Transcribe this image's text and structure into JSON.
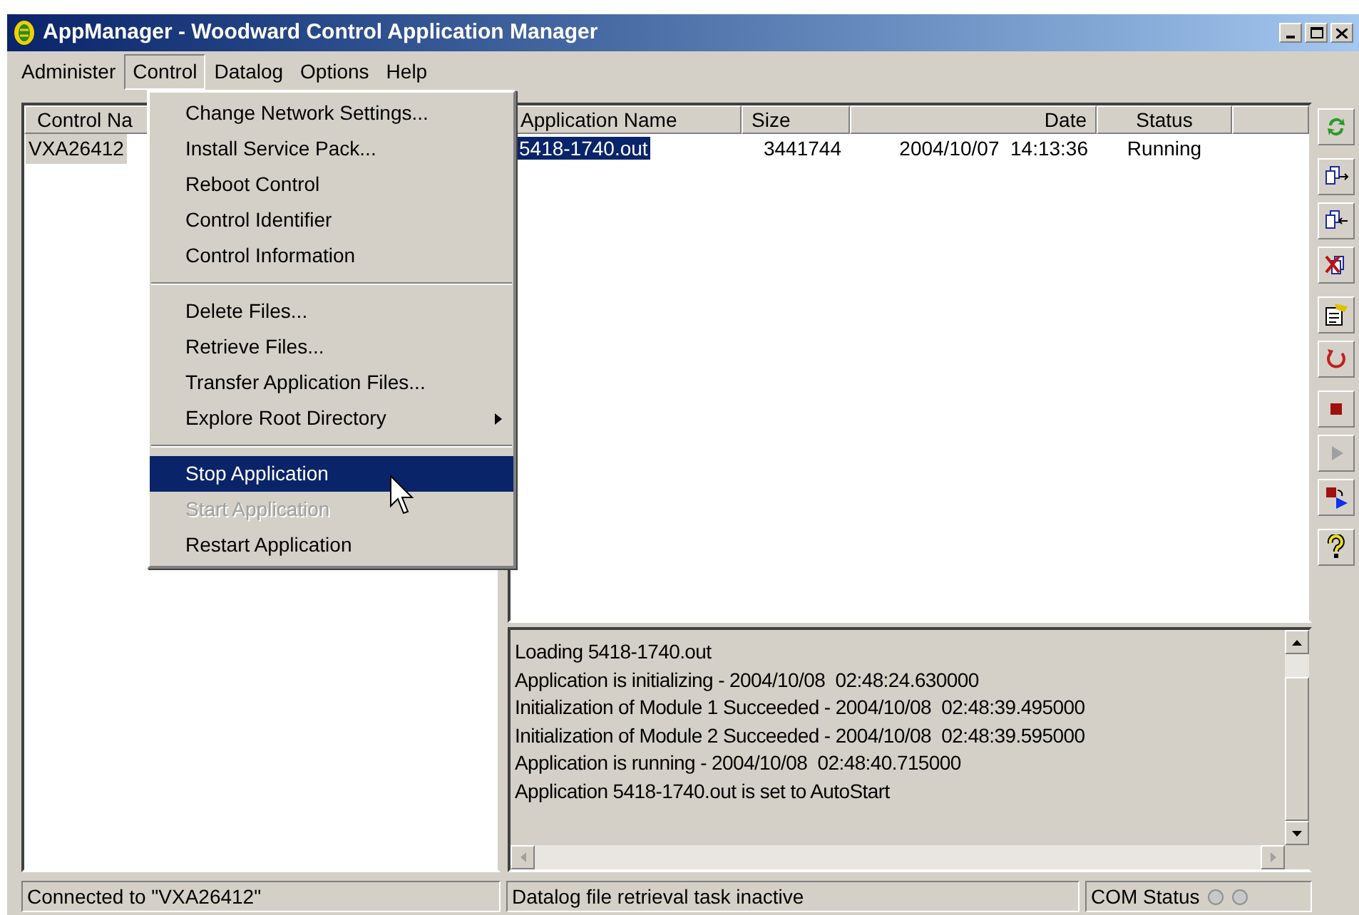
{
  "window": {
    "title": "AppManager - Woodward Control Application Manager"
  },
  "menu_bar": [
    {
      "label": "Administer",
      "selected": false
    },
    {
      "label": "Control",
      "selected": true
    },
    {
      "label": "Datalog",
      "selected": false
    },
    {
      "label": "Options",
      "selected": false
    },
    {
      "label": "Help",
      "selected": false
    }
  ],
  "dropdown": [
    {
      "kind": "item",
      "label": "Change Network Settings...",
      "selected": false,
      "disabled": false
    },
    {
      "kind": "item",
      "label": "Install Service Pack...",
      "selected": false,
      "disabled": false
    },
    {
      "kind": "item",
      "label": "Reboot Control",
      "selected": false,
      "disabled": false
    },
    {
      "kind": "item",
      "label": "Control Identifier",
      "selected": false,
      "disabled": false
    },
    {
      "kind": "item",
      "label": "Control Information",
      "selected": false,
      "disabled": false
    },
    {
      "kind": "separator"
    },
    {
      "kind": "item",
      "label": "Delete Files...",
      "selected": false,
      "disabled": false
    },
    {
      "kind": "item",
      "label": "Retrieve Files...",
      "selected": false,
      "disabled": false
    },
    {
      "kind": "item",
      "label": "Transfer Application Files...",
      "selected": false,
      "disabled": false
    },
    {
      "kind": "submenu",
      "label": "Explore Root Directory",
      "selected": false,
      "disabled": false
    },
    {
      "kind": "separator"
    },
    {
      "kind": "item",
      "label": "Stop Application",
      "selected": true,
      "disabled": false
    },
    {
      "kind": "item",
      "label": "Start Application",
      "selected": false,
      "disabled": true
    },
    {
      "kind": "item",
      "label": "Restart Application",
      "selected": false,
      "disabled": false
    }
  ],
  "controls_list": {
    "column": "Control Na",
    "rows": [
      {
        "name": "VXA26412",
        "selected": true
      }
    ]
  },
  "applications_table": {
    "columns": [
      "Application Name",
      "Size",
      "Date",
      "Status"
    ],
    "rows": [
      {
        "name": "5418-1740.out",
        "size": "3441744",
        "date": "2004/10/07  14:13:36",
        "status": "Running",
        "selected": true
      }
    ]
  },
  "log": [
    "Loading 5418-1740.out",
    "Application is initializing - 2004/10/08  02:48:24.630000",
    "Initialization of Module 1 Succeeded - 2004/10/08  02:48:39.495000",
    "Initialization of Module 2 Succeeded - 2004/10/08  02:48:39.595000",
    "Application is running - 2004/10/08  02:48:40.715000",
    "Application 5418-1740.out is set to AutoStart"
  ],
  "toolbar": [
    {
      "kind": "refresh",
      "disabled": false
    },
    {
      "kind": "copy-to",
      "disabled": false
    },
    {
      "kind": "copy-from",
      "disabled": false
    },
    {
      "kind": "delete",
      "disabled": false
    },
    {
      "kind": "properties",
      "disabled": false
    },
    {
      "kind": "restart",
      "disabled": false
    },
    {
      "kind": "stop",
      "disabled": false
    },
    {
      "kind": "play",
      "disabled": true
    },
    {
      "kind": "stop-start",
      "disabled": false
    },
    {
      "kind": "help",
      "disabled": false
    }
  ],
  "status_bar": {
    "connection": "Connected to \"VXA26412\"",
    "datalog": "Datalog file retrieval task inactive",
    "com_label": "COM Status"
  }
}
